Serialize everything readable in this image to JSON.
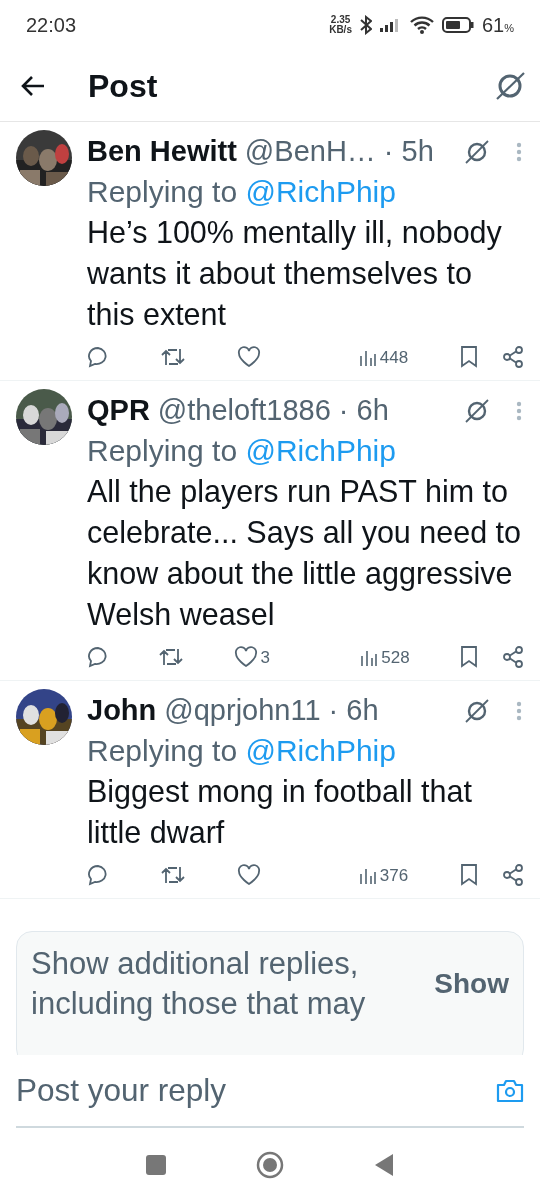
{
  "status_bar": {
    "time": "22:03",
    "net_speed": "2.35",
    "net_unit": "KB/s",
    "battery_text": "61",
    "battery_unit": "%"
  },
  "header": {
    "title": "Post"
  },
  "replies": [
    {
      "name": "Ben Hewitt",
      "handle": "@BenH…",
      "time": "· 5h",
      "reply_label": "Replying to",
      "reply_to": "@RichPhip",
      "text": "He’s 100% mentally ill, nobody wants it about themselves to this extent",
      "views": "448"
    },
    {
      "name": "QPR",
      "handle": "@theloft1886",
      "time": "· 6h",
      "reply_label": "Replying to",
      "reply_to": "@RichPhip",
      "text": "All the players run PAST him to celebrate... Says all you need to know about the little aggressive Welsh weasel",
      "likes": "3",
      "views": "528"
    },
    {
      "name": "John",
      "handle": "@qprjohn11",
      "time": "· 6h",
      "reply_label": "Replying to",
      "reply_to": "@RichPhip",
      "text": "Biggest mong in football that little dwarf",
      "views": "376"
    }
  ],
  "more_replies": {
    "text": "Show additional replies, including those that may",
    "button": "Show"
  },
  "composer": {
    "placeholder": "Post your reply"
  }
}
